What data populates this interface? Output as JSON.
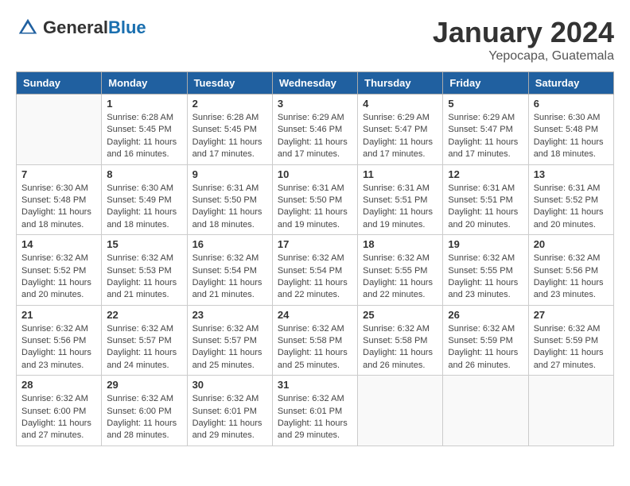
{
  "logo": {
    "text_general": "General",
    "text_blue": "Blue"
  },
  "title": "January 2024",
  "location": "Yepocapa, Guatemala",
  "days_of_week": [
    "Sunday",
    "Monday",
    "Tuesday",
    "Wednesday",
    "Thursday",
    "Friday",
    "Saturday"
  ],
  "weeks": [
    [
      {
        "day": "",
        "sunrise": "",
        "sunset": "",
        "daylight": ""
      },
      {
        "day": "1",
        "sunrise": "Sunrise: 6:28 AM",
        "sunset": "Sunset: 5:45 PM",
        "daylight": "Daylight: 11 hours and 16 minutes."
      },
      {
        "day": "2",
        "sunrise": "Sunrise: 6:28 AM",
        "sunset": "Sunset: 5:45 PM",
        "daylight": "Daylight: 11 hours and 17 minutes."
      },
      {
        "day": "3",
        "sunrise": "Sunrise: 6:29 AM",
        "sunset": "Sunset: 5:46 PM",
        "daylight": "Daylight: 11 hours and 17 minutes."
      },
      {
        "day": "4",
        "sunrise": "Sunrise: 6:29 AM",
        "sunset": "Sunset: 5:47 PM",
        "daylight": "Daylight: 11 hours and 17 minutes."
      },
      {
        "day": "5",
        "sunrise": "Sunrise: 6:29 AM",
        "sunset": "Sunset: 5:47 PM",
        "daylight": "Daylight: 11 hours and 17 minutes."
      },
      {
        "day": "6",
        "sunrise": "Sunrise: 6:30 AM",
        "sunset": "Sunset: 5:48 PM",
        "daylight": "Daylight: 11 hours and 18 minutes."
      }
    ],
    [
      {
        "day": "7",
        "sunrise": "Sunrise: 6:30 AM",
        "sunset": "Sunset: 5:48 PM",
        "daylight": "Daylight: 11 hours and 18 minutes."
      },
      {
        "day": "8",
        "sunrise": "Sunrise: 6:30 AM",
        "sunset": "Sunset: 5:49 PM",
        "daylight": "Daylight: 11 hours and 18 minutes."
      },
      {
        "day": "9",
        "sunrise": "Sunrise: 6:31 AM",
        "sunset": "Sunset: 5:50 PM",
        "daylight": "Daylight: 11 hours and 18 minutes."
      },
      {
        "day": "10",
        "sunrise": "Sunrise: 6:31 AM",
        "sunset": "Sunset: 5:50 PM",
        "daylight": "Daylight: 11 hours and 19 minutes."
      },
      {
        "day": "11",
        "sunrise": "Sunrise: 6:31 AM",
        "sunset": "Sunset: 5:51 PM",
        "daylight": "Daylight: 11 hours and 19 minutes."
      },
      {
        "day": "12",
        "sunrise": "Sunrise: 6:31 AM",
        "sunset": "Sunset: 5:51 PM",
        "daylight": "Daylight: 11 hours and 20 minutes."
      },
      {
        "day": "13",
        "sunrise": "Sunrise: 6:31 AM",
        "sunset": "Sunset: 5:52 PM",
        "daylight": "Daylight: 11 hours and 20 minutes."
      }
    ],
    [
      {
        "day": "14",
        "sunrise": "Sunrise: 6:32 AM",
        "sunset": "Sunset: 5:52 PM",
        "daylight": "Daylight: 11 hours and 20 minutes."
      },
      {
        "day": "15",
        "sunrise": "Sunrise: 6:32 AM",
        "sunset": "Sunset: 5:53 PM",
        "daylight": "Daylight: 11 hours and 21 minutes."
      },
      {
        "day": "16",
        "sunrise": "Sunrise: 6:32 AM",
        "sunset": "Sunset: 5:54 PM",
        "daylight": "Daylight: 11 hours and 21 minutes."
      },
      {
        "day": "17",
        "sunrise": "Sunrise: 6:32 AM",
        "sunset": "Sunset: 5:54 PM",
        "daylight": "Daylight: 11 hours and 22 minutes."
      },
      {
        "day": "18",
        "sunrise": "Sunrise: 6:32 AM",
        "sunset": "Sunset: 5:55 PM",
        "daylight": "Daylight: 11 hours and 22 minutes."
      },
      {
        "day": "19",
        "sunrise": "Sunrise: 6:32 AM",
        "sunset": "Sunset: 5:55 PM",
        "daylight": "Daylight: 11 hours and 23 minutes."
      },
      {
        "day": "20",
        "sunrise": "Sunrise: 6:32 AM",
        "sunset": "Sunset: 5:56 PM",
        "daylight": "Daylight: 11 hours and 23 minutes."
      }
    ],
    [
      {
        "day": "21",
        "sunrise": "Sunrise: 6:32 AM",
        "sunset": "Sunset: 5:56 PM",
        "daylight": "Daylight: 11 hours and 23 minutes."
      },
      {
        "day": "22",
        "sunrise": "Sunrise: 6:32 AM",
        "sunset": "Sunset: 5:57 PM",
        "daylight": "Daylight: 11 hours and 24 minutes."
      },
      {
        "day": "23",
        "sunrise": "Sunrise: 6:32 AM",
        "sunset": "Sunset: 5:57 PM",
        "daylight": "Daylight: 11 hours and 25 minutes."
      },
      {
        "day": "24",
        "sunrise": "Sunrise: 6:32 AM",
        "sunset": "Sunset: 5:58 PM",
        "daylight": "Daylight: 11 hours and 25 minutes."
      },
      {
        "day": "25",
        "sunrise": "Sunrise: 6:32 AM",
        "sunset": "Sunset: 5:58 PM",
        "daylight": "Daylight: 11 hours and 26 minutes."
      },
      {
        "day": "26",
        "sunrise": "Sunrise: 6:32 AM",
        "sunset": "Sunset: 5:59 PM",
        "daylight": "Daylight: 11 hours and 26 minutes."
      },
      {
        "day": "27",
        "sunrise": "Sunrise: 6:32 AM",
        "sunset": "Sunset: 5:59 PM",
        "daylight": "Daylight: 11 hours and 27 minutes."
      }
    ],
    [
      {
        "day": "28",
        "sunrise": "Sunrise: 6:32 AM",
        "sunset": "Sunset: 6:00 PM",
        "daylight": "Daylight: 11 hours and 27 minutes."
      },
      {
        "day": "29",
        "sunrise": "Sunrise: 6:32 AM",
        "sunset": "Sunset: 6:00 PM",
        "daylight": "Daylight: 11 hours and 28 minutes."
      },
      {
        "day": "30",
        "sunrise": "Sunrise: 6:32 AM",
        "sunset": "Sunset: 6:01 PM",
        "daylight": "Daylight: 11 hours and 29 minutes."
      },
      {
        "day": "31",
        "sunrise": "Sunrise: 6:32 AM",
        "sunset": "Sunset: 6:01 PM",
        "daylight": "Daylight: 11 hours and 29 minutes."
      },
      {
        "day": "",
        "sunrise": "",
        "sunset": "",
        "daylight": ""
      },
      {
        "day": "",
        "sunrise": "",
        "sunset": "",
        "daylight": ""
      },
      {
        "day": "",
        "sunrise": "",
        "sunset": "",
        "daylight": ""
      }
    ]
  ]
}
